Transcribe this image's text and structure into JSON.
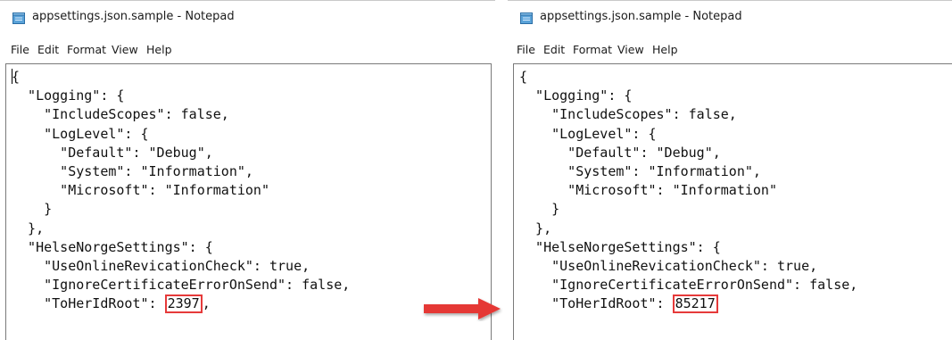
{
  "left_window": {
    "title": "appsettings.json.sample - Notepad",
    "menu": [
      "File",
      "Edit",
      "Format",
      "View",
      "Help"
    ],
    "lines": [
      "{",
      "  \"Logging\": {",
      "    \"IncludeScopes\": false,",
      "    \"LogLevel\": {",
      "      \"Default\": \"Debug\",",
      "      \"System\": \"Information\",",
      "      \"Microsoft\": \"Information\"",
      "    }",
      "  },",
      "  \"HelseNorgeSettings\": {",
      "    \"UseOnlineRevicationCheck\": true,",
      "    \"IgnoreCertificateErrorOnSend\": false,"
    ],
    "last_line_prefix": "    \"ToHerIdRoot\": ",
    "highlighted_value": "2397",
    "last_line_suffix": ","
  },
  "right_window": {
    "title": "appsettings.json.sample - Notepad",
    "menu": [
      "File",
      "Edit",
      "Format",
      "View",
      "Help"
    ],
    "lines": [
      "{",
      "  \"Logging\": {",
      "    \"IncludeScopes\": false,",
      "    \"LogLevel\": {",
      "      \"Default\": \"Debug\",",
      "      \"System\": \"Information\",",
      "      \"Microsoft\": \"Information\"",
      "    }",
      "  },",
      "  \"HelseNorgeSettings\": {",
      "    \"UseOnlineRevicationCheck\": true,",
      "    \"IgnoreCertificateErrorOnSend\": false,"
    ],
    "last_line_prefix": "    \"ToHerIdRoot\": ",
    "highlighted_value": "85217",
    "last_line_suffix": ""
  },
  "colors": {
    "highlight_border": "#e63a3a",
    "arrow": "#e53935"
  },
  "icons": {
    "notepad": "notepad-icon",
    "arrow": "right-arrow-icon"
  }
}
